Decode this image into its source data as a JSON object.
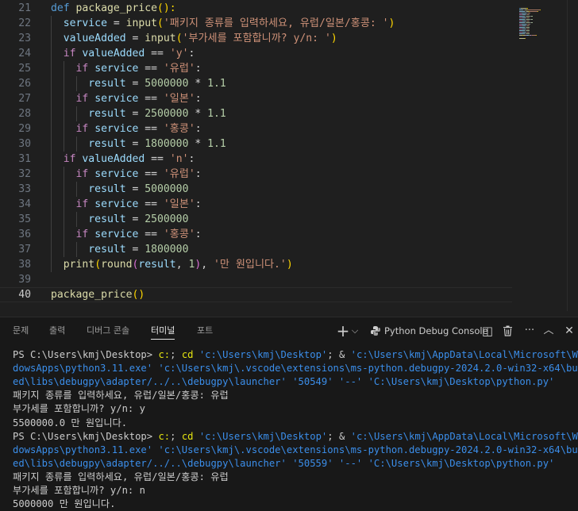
{
  "editor": {
    "lines": [
      {
        "n": "21",
        "tokens": [
          {
            "t": "def ",
            "c": "def"
          },
          {
            "t": "package_price",
            "c": "fn"
          },
          {
            "t": "():",
            "c": "b1"
          }
        ]
      },
      {
        "n": "22",
        "tokens": [
          {
            "t": "  service",
            "c": "var"
          },
          {
            "t": " = ",
            "c": "op"
          },
          {
            "t": "input",
            "c": "fn"
          },
          {
            "t": "(",
            "c": "b1"
          },
          {
            "t": "'패키지 종류를 입력하세요, 유럽/일본/홍콩: '",
            "c": "str"
          },
          {
            "t": ")",
            "c": "b1"
          }
        ]
      },
      {
        "n": "23",
        "tokens": [
          {
            "t": "  valueAdded",
            "c": "var"
          },
          {
            "t": " = ",
            "c": "op"
          },
          {
            "t": "input",
            "c": "fn"
          },
          {
            "t": "(",
            "c": "b1"
          },
          {
            "t": "'부가세를 포함합니까? y/n: '",
            "c": "str"
          },
          {
            "t": ")",
            "c": "b1"
          }
        ]
      },
      {
        "n": "24",
        "tokens": [
          {
            "t": "  if ",
            "c": "kw"
          },
          {
            "t": "valueAdded",
            "c": "var"
          },
          {
            "t": " == ",
            "c": "op"
          },
          {
            "t": "'y'",
            "c": "str"
          },
          {
            "t": ":",
            "c": "op"
          }
        ]
      },
      {
        "n": "25",
        "tokens": [
          {
            "t": "    if ",
            "c": "kw"
          },
          {
            "t": "service",
            "c": "var"
          },
          {
            "t": " == ",
            "c": "op"
          },
          {
            "t": "'유럽'",
            "c": "str"
          },
          {
            "t": ":",
            "c": "op"
          }
        ]
      },
      {
        "n": "26",
        "tokens": [
          {
            "t": "      result",
            "c": "var"
          },
          {
            "t": " = ",
            "c": "op"
          },
          {
            "t": "5000000",
            "c": "num"
          },
          {
            "t": " * ",
            "c": "op"
          },
          {
            "t": "1.1",
            "c": "num"
          }
        ]
      },
      {
        "n": "27",
        "tokens": [
          {
            "t": "    if ",
            "c": "kw"
          },
          {
            "t": "service",
            "c": "var"
          },
          {
            "t": " == ",
            "c": "op"
          },
          {
            "t": "'일본'",
            "c": "str"
          },
          {
            "t": ":",
            "c": "op"
          }
        ]
      },
      {
        "n": "28",
        "tokens": [
          {
            "t": "      result",
            "c": "var"
          },
          {
            "t": " = ",
            "c": "op"
          },
          {
            "t": "2500000",
            "c": "num"
          },
          {
            "t": " * ",
            "c": "op"
          },
          {
            "t": "1.1",
            "c": "num"
          }
        ]
      },
      {
        "n": "29",
        "tokens": [
          {
            "t": "    if ",
            "c": "kw"
          },
          {
            "t": "service",
            "c": "var"
          },
          {
            "t": " == ",
            "c": "op"
          },
          {
            "t": "'홍콩'",
            "c": "str"
          },
          {
            "t": ":",
            "c": "op"
          }
        ]
      },
      {
        "n": "30",
        "tokens": [
          {
            "t": "      result",
            "c": "var"
          },
          {
            "t": " = ",
            "c": "op"
          },
          {
            "t": "1800000",
            "c": "num"
          },
          {
            "t": " * ",
            "c": "op"
          },
          {
            "t": "1.1",
            "c": "num"
          }
        ]
      },
      {
        "n": "31",
        "tokens": [
          {
            "t": "  if ",
            "c": "kw"
          },
          {
            "t": "valueAdded",
            "c": "var"
          },
          {
            "t": " == ",
            "c": "op"
          },
          {
            "t": "'n'",
            "c": "str"
          },
          {
            "t": ":",
            "c": "op"
          }
        ]
      },
      {
        "n": "32",
        "tokens": [
          {
            "t": "    if ",
            "c": "kw"
          },
          {
            "t": "service",
            "c": "var"
          },
          {
            "t": " == ",
            "c": "op"
          },
          {
            "t": "'유럽'",
            "c": "str"
          },
          {
            "t": ":",
            "c": "op"
          }
        ]
      },
      {
        "n": "33",
        "tokens": [
          {
            "t": "      result",
            "c": "var"
          },
          {
            "t": " = ",
            "c": "op"
          },
          {
            "t": "5000000",
            "c": "num"
          }
        ]
      },
      {
        "n": "34",
        "tokens": [
          {
            "t": "    if ",
            "c": "kw"
          },
          {
            "t": "service",
            "c": "var"
          },
          {
            "t": " == ",
            "c": "op"
          },
          {
            "t": "'일본'",
            "c": "str"
          },
          {
            "t": ":",
            "c": "op"
          }
        ]
      },
      {
        "n": "35",
        "tokens": [
          {
            "t": "      result",
            "c": "var"
          },
          {
            "t": " = ",
            "c": "op"
          },
          {
            "t": "2500000",
            "c": "num"
          }
        ]
      },
      {
        "n": "36",
        "tokens": [
          {
            "t": "    if ",
            "c": "kw"
          },
          {
            "t": "service",
            "c": "var"
          },
          {
            "t": " == ",
            "c": "op"
          },
          {
            "t": "'홍콩'",
            "c": "str"
          },
          {
            "t": ":",
            "c": "op"
          }
        ]
      },
      {
        "n": "37",
        "tokens": [
          {
            "t": "      result",
            "c": "var"
          },
          {
            "t": " = ",
            "c": "op"
          },
          {
            "t": "1800000",
            "c": "num"
          }
        ]
      },
      {
        "n": "38",
        "tokens": [
          {
            "t": "  print",
            "c": "fn"
          },
          {
            "t": "(",
            "c": "b1"
          },
          {
            "t": "round",
            "c": "fn"
          },
          {
            "t": "(",
            "c": "b2"
          },
          {
            "t": "result",
            "c": "var"
          },
          {
            "t": ", ",
            "c": "op"
          },
          {
            "t": "1",
            "c": "num"
          },
          {
            "t": ")",
            "c": "b2"
          },
          {
            "t": ", ",
            "c": "op"
          },
          {
            "t": "'만 원입니다.'",
            "c": "str"
          },
          {
            "t": ")",
            "c": "b1"
          }
        ]
      },
      {
        "n": "39",
        "tokens": []
      },
      {
        "n": "40",
        "active": true,
        "tokens": [
          {
            "t": "package_price",
            "c": "fn"
          },
          {
            "t": "()",
            "c": "b1"
          }
        ]
      }
    ]
  },
  "panel": {
    "tabs": [
      "문제",
      "출력",
      "디버그 콘솔",
      "터미널",
      "포트"
    ],
    "active_tab": "터미널",
    "terminal_name": "Python Debug Console",
    "icons": {
      "add": "+",
      "dropdown": "⌵",
      "split": "◫",
      "trash": "🗑",
      "more": "···",
      "maximize": "︿",
      "close": "✕"
    }
  },
  "terminal": {
    "lines": [
      [
        {
          "t": "PS C:\\Users\\kmj\\Desktop> ",
          "c": "ps"
        },
        {
          "t": "c:",
          "c": "t-y"
        },
        {
          "t": "; ",
          "c": "t-w"
        },
        {
          "t": "cd",
          "c": "t-y"
        },
        {
          "t": " 'c:\\Users\\kmj\\Desktop'",
          "c": "t-c"
        },
        {
          "t": "; & ",
          "c": "t-w"
        },
        {
          "t": "'c:\\Users\\kmj\\AppData\\Local\\Microsoft\\Win",
          "c": "t-c"
        }
      ],
      [
        {
          "t": "dowsApps\\python3.11.exe' 'c:\\Users\\kmj\\.vscode\\extensions\\ms-python.debugpy-2024.2.0-win32-x64\\bundl",
          "c": "t-c"
        }
      ],
      [
        {
          "t": "ed\\libs\\debugpy\\adapter/../..\\debugpy\\launcher' '50549' '--' 'C:\\Users\\kmj\\Desktop\\python.py'",
          "c": "t-c"
        }
      ],
      [
        {
          "t": "패키지 종류를 입력하세요, 유럽/일본/홍콩: 유럽",
          "c": "t-w"
        }
      ],
      [
        {
          "t": "부가세를 포함합니까? y/n: y",
          "c": "t-w"
        }
      ],
      [
        {
          "t": "5500000.0 만 원입니다.",
          "c": "t-w"
        }
      ],
      [
        {
          "t": "PS C:\\Users\\kmj\\Desktop> ",
          "c": "ps"
        },
        {
          "t": "c:",
          "c": "t-y"
        },
        {
          "t": "; ",
          "c": "t-w"
        },
        {
          "t": "cd",
          "c": "t-y"
        },
        {
          "t": " 'c:\\Users\\kmj\\Desktop'",
          "c": "t-c"
        },
        {
          "t": "; & ",
          "c": "t-w"
        },
        {
          "t": "'c:\\Users\\kmj\\AppData\\Local\\Microsoft\\Win",
          "c": "t-c"
        }
      ],
      [
        {
          "t": "dowsApps\\python3.11.exe' 'c:\\Users\\kmj\\.vscode\\extensions\\ms-python.debugpy-2024.2.0-win32-x64\\bundl",
          "c": "t-c"
        }
      ],
      [
        {
          "t": "ed\\libs\\debugpy\\adapter/../..\\debugpy\\launcher' '50559' '--' 'C:\\Users\\kmj\\Desktop\\python.py'",
          "c": "t-c"
        }
      ],
      [
        {
          "t": "패키지 종류를 입력하세요, 유럽/일본/홍콩: 유럽",
          "c": "t-w"
        }
      ],
      [
        {
          "t": "부가세를 포함합니까? y/n: n",
          "c": "t-w"
        }
      ],
      [
        {
          "t": "5000000 만 원입니다.",
          "c": "t-w"
        }
      ]
    ]
  }
}
